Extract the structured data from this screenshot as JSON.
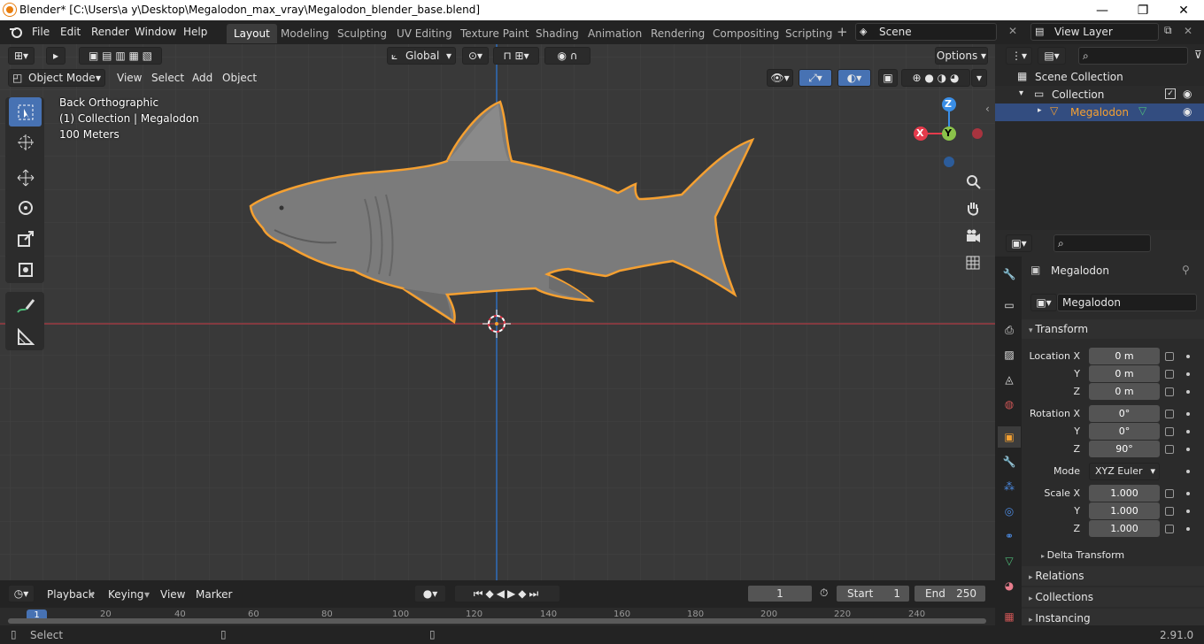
{
  "window": {
    "title": "Blender* [C:\\Users\\a y\\Desktop\\Megalodon_max_vray\\Megalodon_blender_base.blend]",
    "minimize": "—",
    "maximize": "❐",
    "close": "✕"
  },
  "menu": [
    "File",
    "Edit",
    "Render",
    "Window",
    "Help"
  ],
  "workspaces": [
    "Layout",
    "Modeling",
    "Sculpting",
    "UV Editing",
    "Texture Paint",
    "Shading",
    "Animation",
    "Rendering",
    "Compositing",
    "Scripting"
  ],
  "active_workspace": "Layout",
  "scene": {
    "label": "Scene",
    "view_layer": "View Layer"
  },
  "viewport": {
    "transform_orientation": "Global",
    "options": "Options",
    "mode": "Object Mode",
    "menus": [
      "View",
      "Select",
      "Add",
      "Object"
    ],
    "view_name": "Back Orthographic",
    "collection_info": "(1) Collection | Megalodon",
    "scale_info": "100 Meters",
    "gizmo": {
      "z": "Z",
      "x": "X",
      "y": "Y"
    }
  },
  "outliner": {
    "root": "Scene Collection",
    "collection": "Collection",
    "object": "Megalodon"
  },
  "properties": {
    "object_name": "Megalodon",
    "data_name": "Megalodon",
    "transform_header": "Transform",
    "location_label": "Location X",
    "rotation_label": "Rotation X",
    "scale_label": "Scale X",
    "y": "Y",
    "z": "Z",
    "location": [
      "0 m",
      "0 m",
      "0 m"
    ],
    "rotation": [
      "0°",
      "0°",
      "90°"
    ],
    "mode_label": "Mode",
    "mode_value": "XYZ Euler",
    "scale": [
      "1.000",
      "1.000",
      "1.000"
    ],
    "delta": "Delta Transform",
    "relations": "Relations",
    "collections": "Collections",
    "instancing": "Instancing"
  },
  "timeline": {
    "menus": [
      "Playback",
      "Keying",
      "View",
      "Marker"
    ],
    "current_frame": "1",
    "start_label": "Start",
    "start": "1",
    "end_label": "End",
    "end": "250",
    "ruler": [
      "1",
      "20",
      "40",
      "60",
      "80",
      "100",
      "120",
      "140",
      "160",
      "180",
      "200",
      "220",
      "240"
    ]
  },
  "status": {
    "left": "Select",
    "version": "2.91.0"
  },
  "colors": {
    "accent": "#4772b3",
    "selection_outline": "#f5a031",
    "x_axis": "#e53b4c",
    "y_axis": "#8bc34a",
    "z_axis": "#3a8ee6"
  }
}
